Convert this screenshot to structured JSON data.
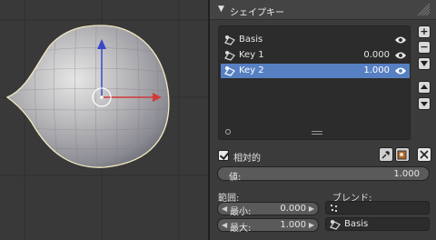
{
  "panel": {
    "title": "シェイプキー",
    "keys": [
      {
        "name": "Basis",
        "value": "",
        "selected": false
      },
      {
        "name": "Key 1",
        "value": "0.000",
        "selected": false
      },
      {
        "name": "Key 2",
        "value": "1.000",
        "selected": true
      }
    ],
    "side_buttons": {
      "add": "+",
      "remove": "−"
    },
    "relative_label": "相対的",
    "value_label": "値:",
    "value": "1.000",
    "range_label": "範囲:",
    "min_label": "最小:",
    "min_value": "0.000",
    "max_label": "最大:",
    "max_value": "1.000",
    "blend_label": "ブレンド:",
    "relative_key": "Basis"
  },
  "icons": {
    "collapse": "triangle-down-icon",
    "shape_key": "shape-key-icon",
    "visibility": "eye-icon",
    "pin": "pin-icon",
    "edit_mode": "edit-mode-icon",
    "close": "close-x-icon",
    "vertex_group": "vertex-group-icon"
  },
  "colors": {
    "selection": "#5680c2",
    "axis_x": "#d23a3a",
    "axis_y": "#3a48c8",
    "mesh_outline": "#f2e9c2"
  }
}
